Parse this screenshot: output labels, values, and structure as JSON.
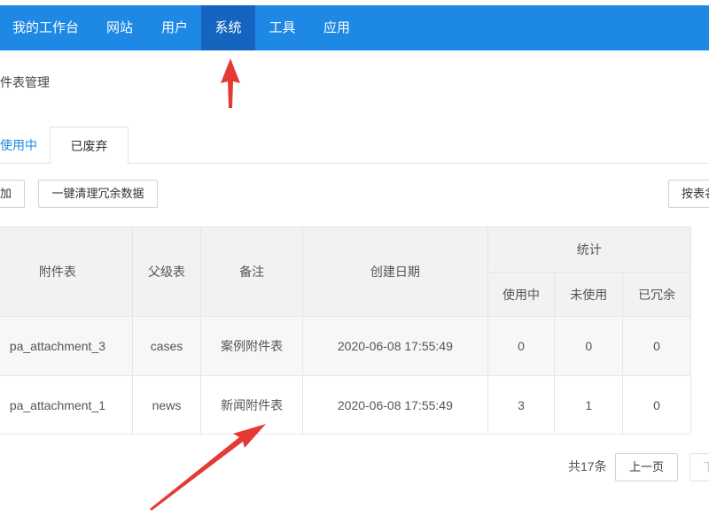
{
  "nav": {
    "items": [
      {
        "label": "我的工作台"
      },
      {
        "label": "网站"
      },
      {
        "label": "用户"
      },
      {
        "label": "系统",
        "active": true
      },
      {
        "label": "工具"
      },
      {
        "label": "应用"
      }
    ]
  },
  "breadcrumb": "附件表管理",
  "tabs": [
    {
      "label": "使用中",
      "active": true
    },
    {
      "label": "已废弃"
    }
  ],
  "toolbar": {
    "add_label": "添加",
    "clean_label": "一键清理冗余数据",
    "right_label": "按表名"
  },
  "table": {
    "headers": {
      "name": "附件表",
      "parent": "父级表",
      "remark": "备注",
      "created": "创建日期",
      "stats": "统计",
      "in_use": "使用中",
      "unused": "未使用",
      "redundant": "已冗余"
    },
    "rows": [
      {
        "name": "pa_attachment_3",
        "parent": "cases",
        "remark": "案例附件表",
        "created": "2020-06-08 17:55:49",
        "in_use": "0",
        "unused": "0",
        "redundant": "0"
      },
      {
        "name": "pa_attachment_1",
        "parent": "news",
        "remark": "新闻附件表",
        "created": "2020-06-08 17:55:49",
        "in_use": "3",
        "unused": "1",
        "redundant": "0"
      }
    ]
  },
  "pager": {
    "total": "共17条",
    "prev": "上一页",
    "next": "下"
  },
  "colors": {
    "nav_bg": "#1e88e5",
    "nav_active": "#1565c0",
    "accent": "#1e88e5",
    "annotation_arrow": "#e53935"
  }
}
